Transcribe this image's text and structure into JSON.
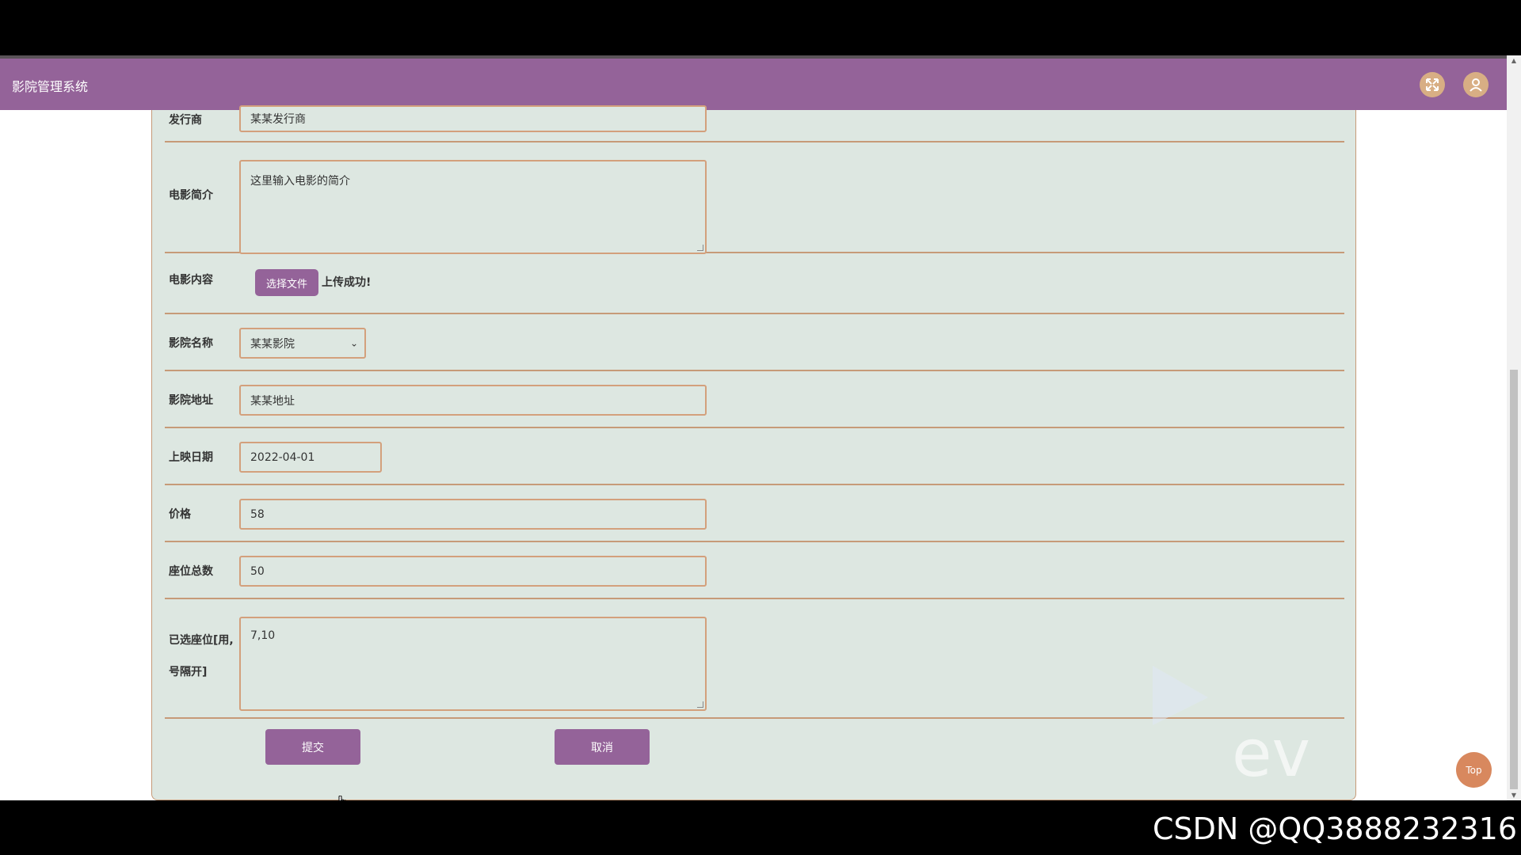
{
  "app": {
    "title": "影院管理系统",
    "fullscreen_icon": "expand-icon",
    "user_icon": "user-icon"
  },
  "form": {
    "publisher": {
      "label": "发行商",
      "value": "某某发行商"
    },
    "synopsis": {
      "label": "电影简介",
      "value": "这里输入电影的简介"
    },
    "content": {
      "label": "电影内容",
      "button": "选择文件",
      "status": "上传成功!"
    },
    "cinema_name": {
      "label": "影院名称",
      "value": "某某影院"
    },
    "cinema_address": {
      "label": "影院地址",
      "value": "某某地址"
    },
    "release_date": {
      "label": "上映日期",
      "value": "2022-04-01"
    },
    "price": {
      "label": "价格",
      "value": "58"
    },
    "total_seats": {
      "label": "座位总数",
      "value": "50"
    },
    "selected_seats": {
      "label_line1": "已选座位[用,",
      "label_line2": "号隔开]",
      "value": "7,10"
    },
    "submit": "提交",
    "cancel": "取消"
  },
  "top_button": "Top",
  "watermark": "ev",
  "footer": "CSDN @QQ3888232316",
  "colors": {
    "header": "#946399",
    "panel": "#dde7e1",
    "border": "#c69a78",
    "accent": "#d8ae84"
  }
}
